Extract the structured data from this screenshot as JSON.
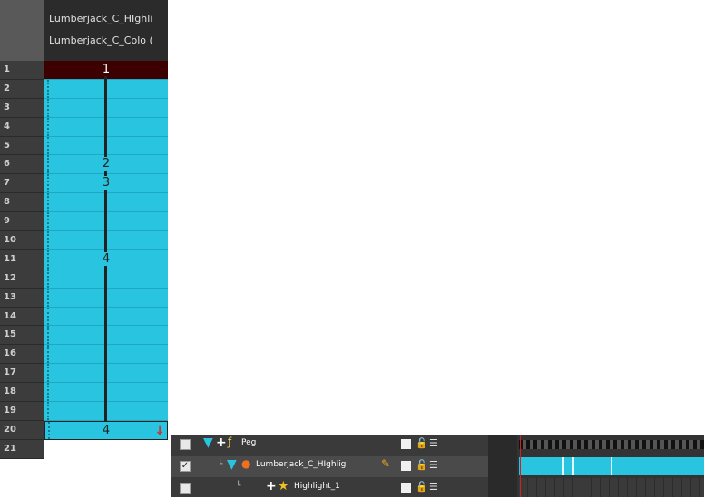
{
  "xsheet": {
    "column_names": [
      "Lumberjack_C_HIghli",
      "Lumberjack_C_Colo ("
    ],
    "frames": [
      "1",
      "2",
      "3",
      "4",
      "5",
      "6",
      "7",
      "8",
      "9",
      "10",
      "11",
      "12",
      "13",
      "14",
      "15",
      "16",
      "17",
      "18",
      "19",
      "20",
      "21"
    ],
    "cells": [
      "1",
      "",
      "",
      "",
      "",
      "2",
      "3",
      "",
      "",
      "",
      "4",
      "",
      "",
      "",
      "",
      "",
      "",
      "",
      "",
      "4",
      ""
    ],
    "colors": {
      "cell": "#29c4df",
      "first_cell": "#3d0000",
      "frame_col": "#3c3c3c"
    }
  },
  "timeline": {
    "layers": [
      {
        "name": "Peg",
        "checked": false
      },
      {
        "name": "Lumberjack_C_HIghlig",
        "checked": true
      },
      {
        "name": "Highlight_1",
        "checked": false
      }
    ]
  }
}
